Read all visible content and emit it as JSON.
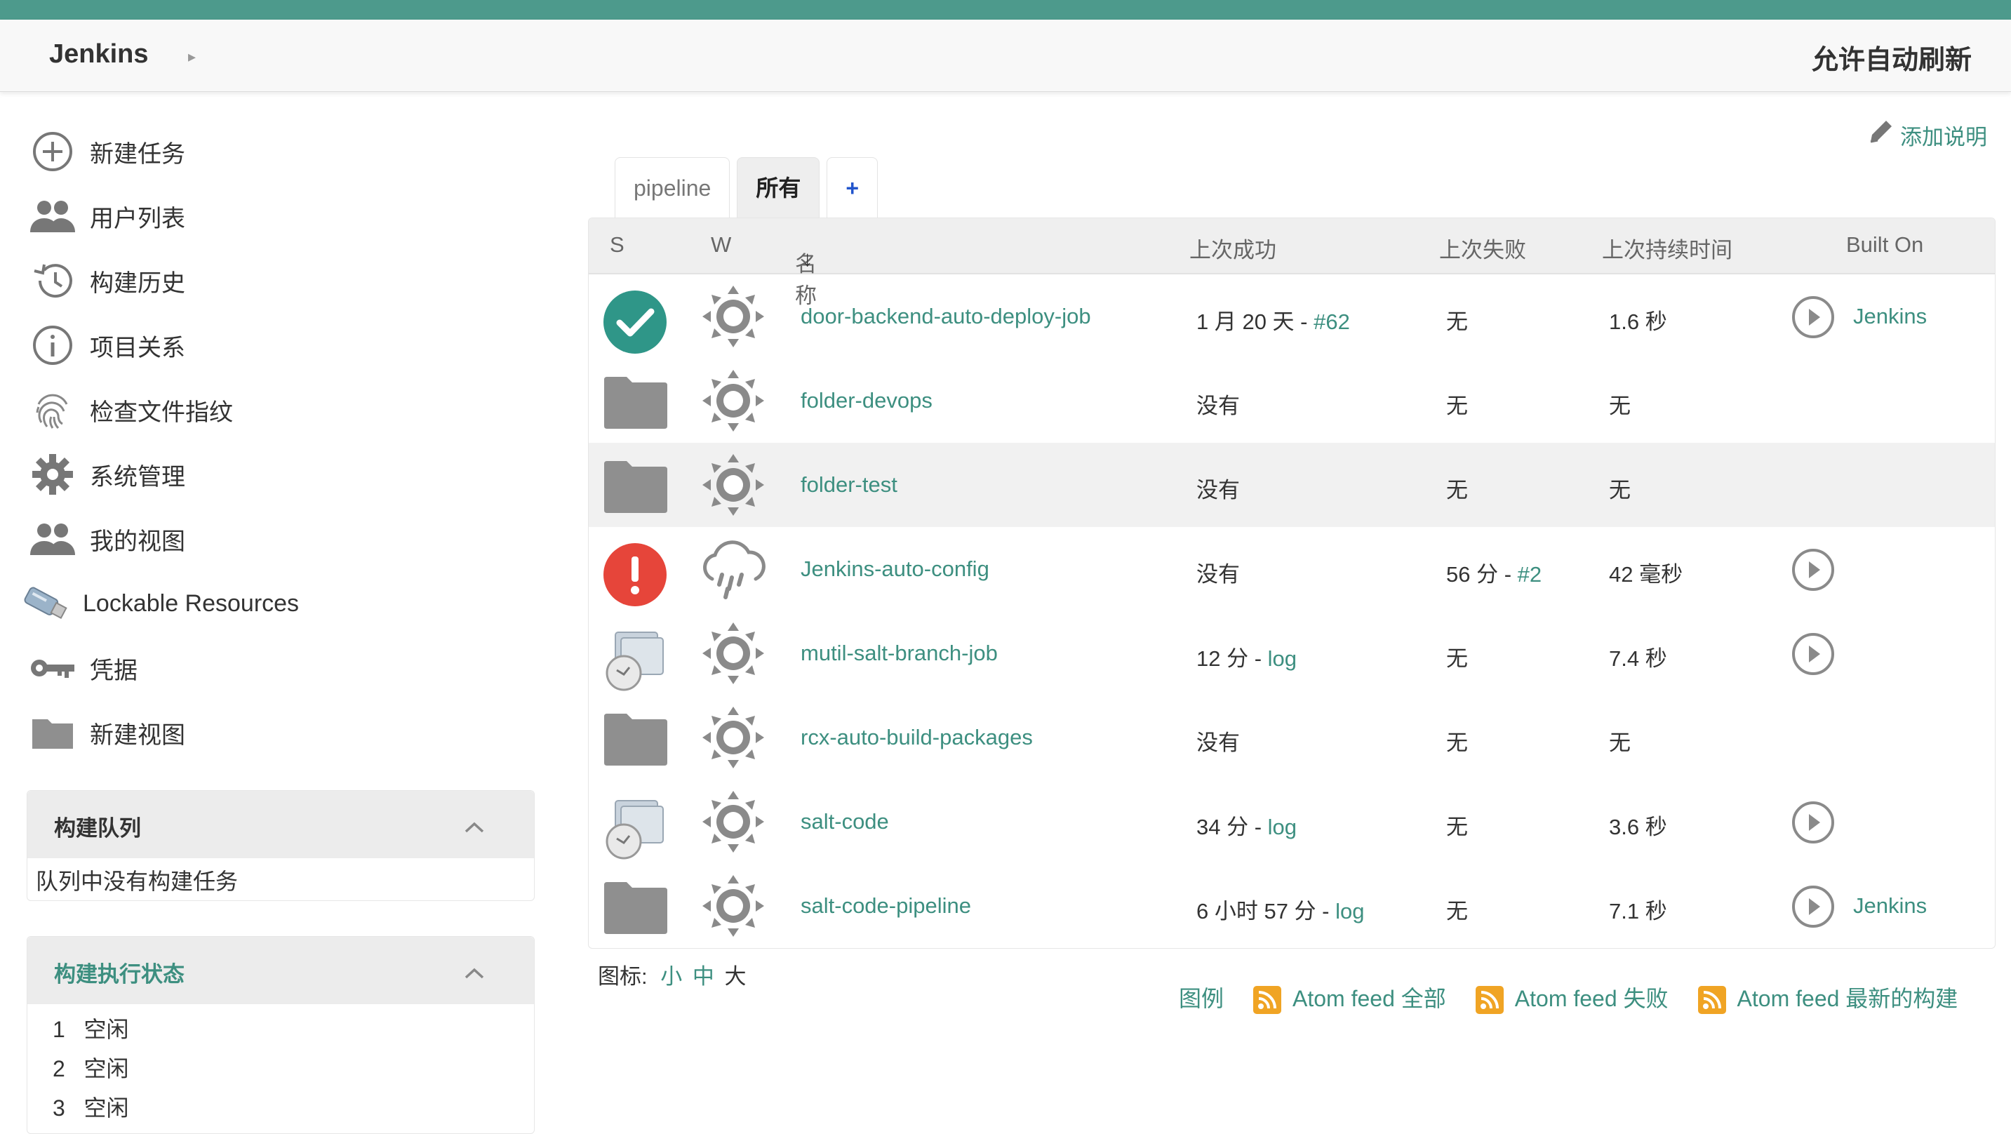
{
  "header": {
    "brand": "Jenkins",
    "auto_refresh": "允许自动刷新"
  },
  "sidebar": {
    "items": [
      {
        "label": "新建任务",
        "icon": "plus-circle-icon"
      },
      {
        "label": "用户列表",
        "icon": "people-icon"
      },
      {
        "label": "构建历史",
        "icon": "history-icon"
      },
      {
        "label": "项目关系",
        "icon": "info-icon"
      },
      {
        "label": "检查文件指纹",
        "icon": "fingerprint-icon"
      },
      {
        "label": "系统管理",
        "icon": "gear-icon"
      },
      {
        "label": "我的视图",
        "icon": "people-icon"
      },
      {
        "label": "Lockable Resources",
        "icon": "usb-drive-icon"
      },
      {
        "label": "凭据",
        "icon": "key-icon"
      },
      {
        "label": "新建视图",
        "icon": "folder-icon"
      }
    ]
  },
  "build_queue": {
    "title": "构建队列",
    "empty_text": "队列中没有构建任务"
  },
  "executors": {
    "title": "构建执行状态",
    "rows": [
      {
        "num": "1",
        "status": "空闲"
      },
      {
        "num": "2",
        "status": "空闲"
      },
      {
        "num": "3",
        "status": "空闲"
      }
    ]
  },
  "add_description": "添加说明",
  "tabs": [
    {
      "label": "pipeline",
      "active": false
    },
    {
      "label": "所有",
      "active": true
    },
    {
      "label": "+",
      "active": false
    }
  ],
  "table": {
    "headers": {
      "s": "S",
      "w": "W",
      "name": "名称",
      "sort_arrow": "↓",
      "last_success": "上次成功",
      "last_failure": "上次失败",
      "last_duration": "上次持续时间",
      "built_on": "Built On"
    },
    "rows": [
      {
        "status": "success",
        "weather": "sunny",
        "name": "door-backend-auto-deploy-job",
        "succ_text": "1 月 20 天 - ",
        "succ_link": "#62",
        "fail_text": "无",
        "fail_link": "",
        "duration": "1.6 秒",
        "run": true,
        "built_on": "Jenkins"
      },
      {
        "status": "folder",
        "weather": "sunny",
        "name": "folder-devops",
        "succ_text": "没有",
        "succ_link": "",
        "fail_text": "无",
        "fail_link": "",
        "duration": "无",
        "run": false,
        "built_on": ""
      },
      {
        "status": "folder",
        "weather": "sunny",
        "name": "folder-test",
        "succ_text": "没有",
        "succ_link": "",
        "fail_text": "无",
        "fail_link": "",
        "duration": "无",
        "run": false,
        "built_on": "",
        "highlight": true
      },
      {
        "status": "failed",
        "weather": "rain",
        "name": "Jenkins-auto-config",
        "succ_text": "没有",
        "succ_link": "",
        "fail_text": "56 分 - ",
        "fail_link": "#2",
        "duration": "42 毫秒",
        "run": true,
        "built_on": ""
      },
      {
        "status": "multibranch",
        "weather": "sunny",
        "name": "mutil-salt-branch-job",
        "succ_text": "12 分 - ",
        "succ_link": "log",
        "fail_text": "无",
        "fail_link": "",
        "duration": "7.4 秒",
        "run": true,
        "built_on": ""
      },
      {
        "status": "folder",
        "weather": "sunny",
        "name": "rcx-auto-build-packages",
        "succ_text": "没有",
        "succ_link": "",
        "fail_text": "无",
        "fail_link": "",
        "duration": "无",
        "run": false,
        "built_on": ""
      },
      {
        "status": "multibranch",
        "weather": "sunny",
        "name": "salt-code",
        "succ_text": "34 分 - ",
        "succ_link": "log",
        "fail_text": "无",
        "fail_link": "",
        "duration": "3.6 秒",
        "run": true,
        "built_on": ""
      },
      {
        "status": "folder",
        "weather": "sunny",
        "name": "salt-code-pipeline",
        "succ_text": "6 小时 57 分 - ",
        "succ_link": "log",
        "fail_text": "无",
        "fail_link": "",
        "duration": "7.1 秒",
        "run": true,
        "built_on": "Jenkins"
      }
    ]
  },
  "icon_size": {
    "label": "图标:",
    "small": "小",
    "medium": "中",
    "large": "大"
  },
  "footer_links": {
    "legend": "图例",
    "feed_all": "Atom feed 全部",
    "feed_failed": "Atom feed 失败",
    "feed_latest": "Atom feed 最新的构建"
  },
  "colors": {
    "accent": "#4d9a8c",
    "link": "#3d8f80",
    "success": "#2f9688",
    "failure": "#e6453a",
    "rss": "#f0a424"
  }
}
